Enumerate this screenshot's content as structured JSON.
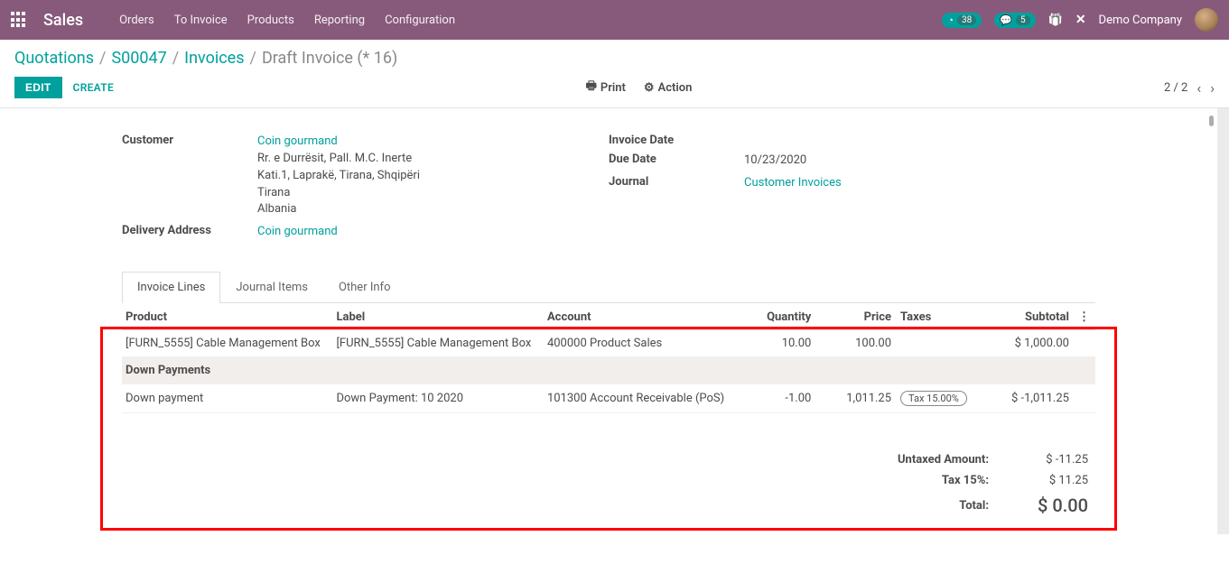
{
  "navbar": {
    "brand": "Sales",
    "links": [
      "Orders",
      "To Invoice",
      "Products",
      "Reporting",
      "Configuration"
    ],
    "timer_badge": "38",
    "chat_badge": "5",
    "company": "Demo Company"
  },
  "breadcrumb": {
    "items": [
      "Quotations",
      "S00047",
      "Invoices"
    ],
    "current": "Draft Invoice (* 16)"
  },
  "buttons": {
    "edit": "EDIT",
    "create": "CREATE",
    "print": "Print",
    "action": "Action",
    "pager": "2 / 2"
  },
  "form": {
    "left": {
      "customer_lbl": "Customer",
      "customer_link": "Coin gourmand",
      "addr_l1": "Rr. e Durrësit, Pall. M.C. Inerte",
      "addr_l2": "Kati.1, Laprakë, Tirana, Shqipëri",
      "addr_l3": "Tirana",
      "addr_l4": "Albania",
      "delivery_lbl": "Delivery Address",
      "delivery_link": "Coin gourmand"
    },
    "right": {
      "invdate_lbl": "Invoice Date",
      "invdate_val": "",
      "duedate_lbl": "Due Date",
      "duedate_val": "10/23/2020",
      "journal_lbl": "Journal",
      "journal_link": "Customer Invoices"
    }
  },
  "tabs": [
    "Invoice Lines",
    "Journal Items",
    "Other Info"
  ],
  "table": {
    "headers": {
      "product": "Product",
      "label": "Label",
      "account": "Account",
      "quantity": "Quantity",
      "price": "Price",
      "taxes": "Taxes",
      "subtotal": "Subtotal"
    },
    "rows": [
      {
        "type": "line",
        "product": "[FURN_5555] Cable Management Box",
        "label": "[FURN_5555] Cable Management Box",
        "account": "400000 Product Sales",
        "quantity": "10.00",
        "price": "100.00",
        "tax": "",
        "subtotal": "$ 1,000.00"
      },
      {
        "type": "section",
        "label": "Down Payments"
      },
      {
        "type": "line",
        "product": "Down payment",
        "label": "Down Payment: 10 2020",
        "account": "101300 Account Receivable (PoS)",
        "quantity": "-1.00",
        "price": "1,011.25",
        "tax": "Tax 15.00%",
        "subtotal": "$ -1,011.25"
      }
    ]
  },
  "totals": {
    "untaxed_lbl": "Untaxed Amount:",
    "untaxed_val": "$ -11.25",
    "tax_lbl": "Tax 15%:",
    "tax_val": "$ 11.25",
    "total_lbl": "Total:",
    "total_val": "$ 0.00"
  },
  "chart_data": {
    "type": "table",
    "title": "Invoice Lines",
    "columns": [
      "Product",
      "Label",
      "Account",
      "Quantity",
      "Price",
      "Taxes",
      "Subtotal"
    ],
    "rows": [
      [
        "[FURN_5555] Cable Management Box",
        "[FURN_5555] Cable Management Box",
        "400000 Product Sales",
        10.0,
        100.0,
        "",
        1000.0
      ],
      [
        "Down payment",
        "Down Payment: 10 2020",
        "101300 Account Receivable (PoS)",
        -1.0,
        1011.25,
        "Tax 15.00%",
        -1011.25
      ]
    ],
    "summary": {
      "Untaxed Amount": -11.25,
      "Tax 15%": 11.25,
      "Total": 0.0
    }
  }
}
